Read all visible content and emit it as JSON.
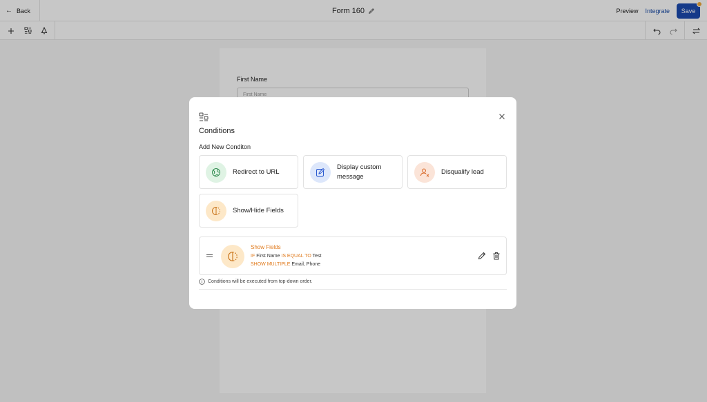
{
  "header": {
    "back_label": "Back",
    "form_title": "Form 160",
    "preview_label": "Preview",
    "integrate_label": "Integrate",
    "save_label": "Save"
  },
  "form": {
    "field_label": "First Name",
    "field_placeholder": "First Name"
  },
  "modal": {
    "title": "Conditions",
    "section_title": "Add New Conditon",
    "options": [
      {
        "label": "Redirect to URL",
        "icon": "globe-icon",
        "color": "#dff3e4"
      },
      {
        "label": "Display custom message",
        "icon": "edit-message-icon",
        "color": "#dde7fb"
      },
      {
        "label": "Disqualify lead",
        "icon": "user-x-icon",
        "color": "#fbe4d8"
      },
      {
        "label": "Show/Hide Fields",
        "icon": "show-hide-icon",
        "color": "#fde8c8"
      }
    ],
    "condition": {
      "title": "Show Fields",
      "if_kw": "IF",
      "if_field": "First Name",
      "op_kw": "IS EQUAL TO",
      "value": "Test",
      "show_kw": "SHOW MULTIPLE",
      "targets": "Email, Phone"
    },
    "note": "Conditions will be executed from top-down order."
  },
  "colors": {
    "accent": "#1b4bb0",
    "link": "#1c4ea8",
    "keyword": "#e07a1c"
  }
}
